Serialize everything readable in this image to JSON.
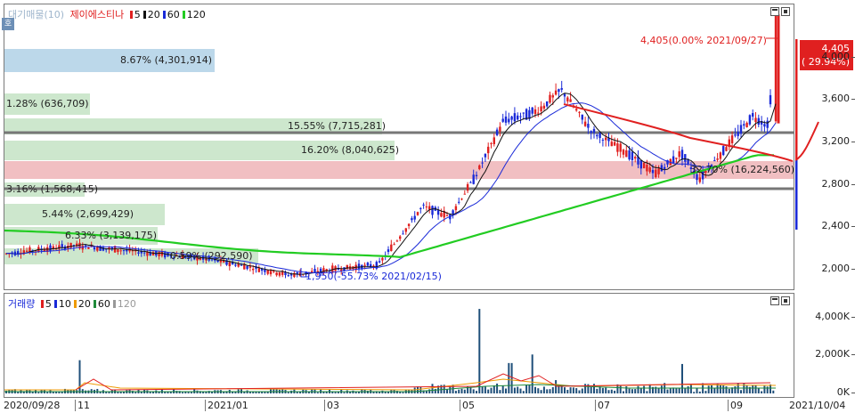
{
  "price_legend": {
    "indicator": "대기매물(10)",
    "stock_name": "제이에스티나",
    "ma": [
      {
        "label": "5",
        "color": "#e02020"
      },
      {
        "label": "20",
        "color": "#111111"
      },
      {
        "label": "60",
        "color": "#1a2ad8"
      },
      {
        "label": "120",
        "color": "#22cc22"
      }
    ]
  },
  "volume_legend": {
    "indicator": "거래량",
    "ma": [
      {
        "label": "5",
        "color": "#e02020"
      },
      {
        "label": "10",
        "color": "#1a2ad8"
      },
      {
        "label": "20",
        "color": "#ee9a00"
      },
      {
        "label": "60",
        "color": "#1f8a3a"
      },
      {
        "label": "120",
        "color": "#999999"
      }
    ]
  },
  "chip": "호",
  "high_annotation": "4,405(0.00% 2021/09/27)",
  "low_annotation": "1,950(-55.73% 2021/02/15)",
  "current_price": {
    "price": "4,405",
    "change": "( 29.94%)"
  },
  "supply_zones": [
    {
      "label": "8.67% (4,301,914)",
      "pct": 8.67,
      "color": "#bcd8ea"
    },
    {
      "label": "1.28% (636,709)",
      "pct": 1.28,
      "color": "#cde7cd"
    },
    {
      "label": "15.55% (7,715,281)",
      "pct": 15.55,
      "color": "#cde7cd"
    },
    {
      "label": "16.20% (8,040,625)",
      "pct": 16.2,
      "color": "#cde7cd"
    },
    {
      "label": "32.70% (16,224,560)",
      "pct": 32.7,
      "color": "#f1bfc2"
    },
    {
      "label": "3.16% (1,568,415)",
      "pct": 3.16,
      "color": "#cde7cd"
    },
    {
      "label": "5.44% (2,699,429)",
      "pct": 5.44,
      "color": "#cde7cd"
    },
    {
      "label": "6.33% (3,139,175)",
      "pct": 6.33,
      "color": "#cde7cd"
    },
    {
      "label": "0.59% (292,590)",
      "pct": 0.59,
      "color": "#cde7cd"
    }
  ],
  "price_axis": [
    "4,000",
    "3,600",
    "3,200",
    "2,800",
    "2,400",
    "2,000"
  ],
  "volume_axis": [
    "4,000K",
    "2,000K",
    "0K"
  ],
  "x_axis": [
    "2020/09/28",
    "11",
    "2021/01",
    "03",
    "05",
    "07",
    "09",
    "2021/10/04"
  ],
  "chart_data": {
    "type": "candlestick",
    "symbol": "제이에스티나",
    "period_start": "2020/09/28",
    "period_end": "2021/10/04",
    "ylim": [
      1800,
      4500
    ],
    "current_price": 4405,
    "current_change_pct": 29.94,
    "period_high": {
      "value": 4405,
      "date": "2021/09/27"
    },
    "period_low": {
      "value": 1950,
      "date": "2021/02/15"
    },
    "approx_close_series": [
      {
        "x": "2020/09/28",
        "close": 2150
      },
      {
        "x": "2020/11",
        "close": 2230
      },
      {
        "x": "2021/01",
        "close": 2100
      },
      {
        "x": "2021/02/15",
        "close": 1950
      },
      {
        "x": "2021/03",
        "close": 2000
      },
      {
        "x": "2021/04",
        "close": 2500
      },
      {
        "x": "2021/05",
        "close": 3150
      },
      {
        "x": "2021/06",
        "close": 3700
      },
      {
        "x": "2021/07",
        "close": 3200
      },
      {
        "x": "2021/08",
        "close": 2950
      },
      {
        "x": "2021/09",
        "close": 3400
      },
      {
        "x": "2021/09/27",
        "close": 4405
      }
    ]
  }
}
